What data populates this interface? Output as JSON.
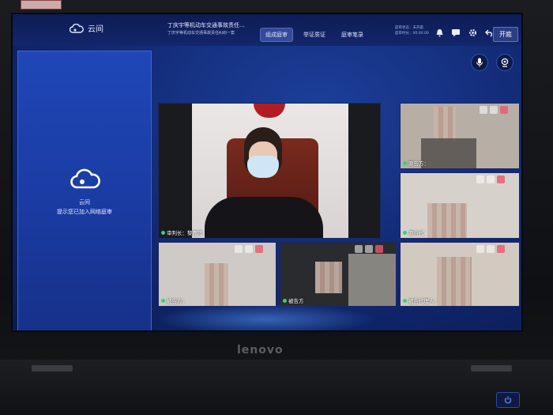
{
  "app": {
    "name": "云间",
    "case_title": "丁庆宇等机动车交通事故责任...",
    "case_subtitle": "丁庆宇等机动车交通事故责任纠纷一案"
  },
  "tabs": [
    {
      "label": "组成庭审",
      "active": true
    },
    {
      "label": "举证质证",
      "active": false
    },
    {
      "label": "庭审笔录",
      "active": false
    }
  ],
  "info": {
    "line1": "庭审状态：未开庭",
    "line2": "庭审时长：00:00:00"
  },
  "open_button": "开庭",
  "side_panel": {
    "name": "云间",
    "note": "提示您已加入网络庭审"
  },
  "participants": {
    "main": "审判长：黎嘉阳",
    "p1": "原告方：",
    "p2": "原告代",
    "p3": "被告方：",
    "p4": "被告方",
    "p5": "被告代理人："
  },
  "bezel_brand": "lenovo",
  "colors": {
    "accent": "#1f47b7",
    "active_dot": "#3bd16f"
  }
}
